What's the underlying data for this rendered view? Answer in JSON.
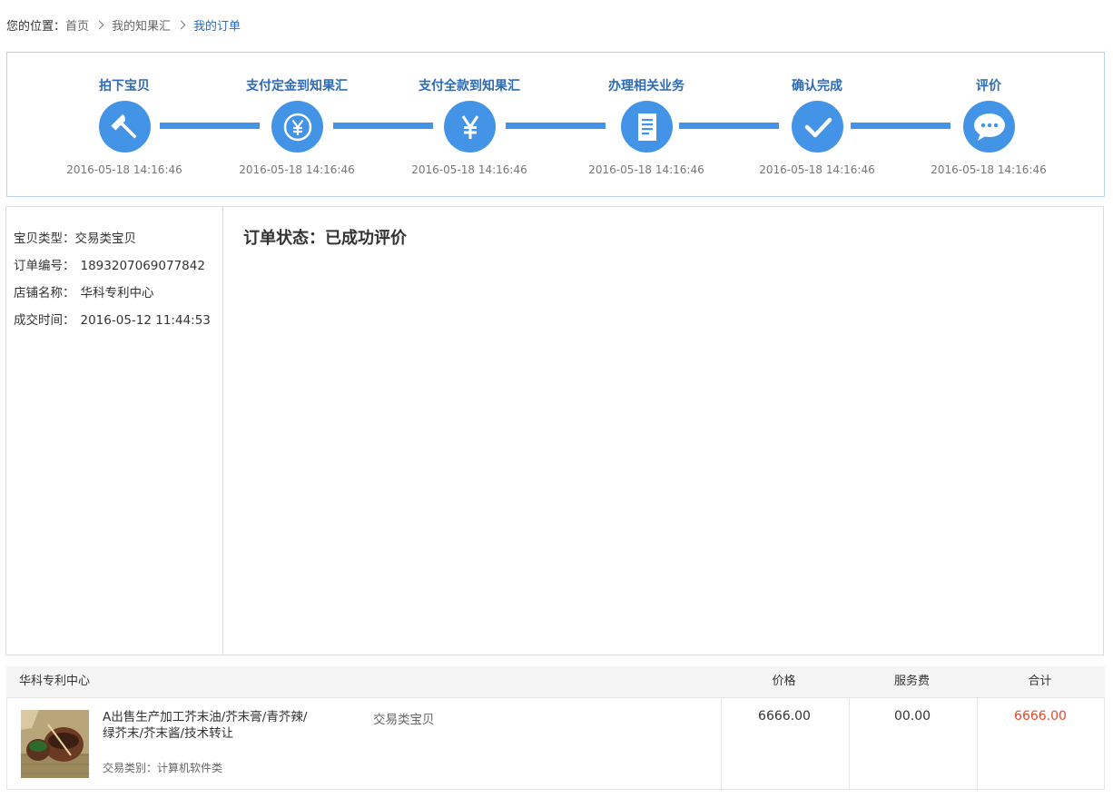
{
  "breadcrumb": {
    "label": "您的位置：",
    "items": [
      "首页",
      "我的知果汇"
    ],
    "current": "我的订单"
  },
  "progress": {
    "color": "#4393e6",
    "steps": [
      {
        "label": "拍下宝贝",
        "icon": "hammer-icon",
        "time": "2016-05-18 14:16:46"
      },
      {
        "label": "支付定金到知果汇",
        "icon": "yen-coin-icon",
        "time": "2016-05-18 14:16:46"
      },
      {
        "label": "支付全款到知果汇",
        "icon": "yen-icon",
        "time": "2016-05-18 14:16:46"
      },
      {
        "label": "办理相关业务",
        "icon": "document-icon",
        "time": "2016-05-18 14:16:46"
      },
      {
        "label": "确认完成",
        "icon": "checkmark-icon",
        "time": "2016-05-18 14:16:46"
      },
      {
        "label": "评价",
        "icon": "chat-bubble-icon",
        "time": "2016-05-18 14:16:46"
      }
    ]
  },
  "order_info": {
    "type_label": "宝贝类型：",
    "type_value": "交易类宝贝",
    "number_label": "订单编号：",
    "number_value": "1893207069077842",
    "shop_label": "店铺名称：",
    "shop_value": "华科专利中心",
    "time_label": "成交时间：",
    "time_value": "2016-05-12 11:44:53"
  },
  "status": {
    "text": "订单状态：已成功评价"
  },
  "table": {
    "shop_name": "华科专利中心",
    "headers": {
      "price": "价格",
      "fee": "服务费",
      "total": "合计"
    },
    "row": {
      "title": "A出售生产加工芥末油/芥末膏/青芥辣/绿芥末/芥末酱/技术转让",
      "type": "交易类宝贝",
      "category": "交易类别：计算机软件类",
      "price": "6666.00",
      "fee": "00.00",
      "total": "6666.00",
      "total_color": "#e6462a"
    }
  }
}
